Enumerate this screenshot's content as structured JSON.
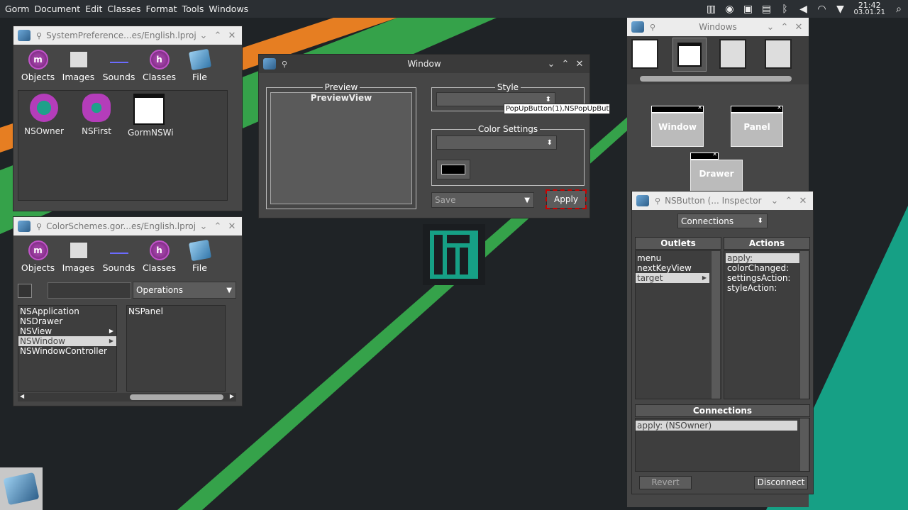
{
  "menubar": {
    "items": [
      "Gorm",
      "Document",
      "Edit",
      "Classes",
      "Format",
      "Tools",
      "Windows"
    ],
    "clock_time": "21:42",
    "clock_date": "03.01.21"
  },
  "palette": {
    "items": [
      "Objects",
      "Images",
      "Sounds",
      "Classes",
      "File"
    ]
  },
  "win_sysprefs": {
    "title": "SystemPreference...es/English.lproj",
    "objects": [
      "NSOwner",
      "NSFirst",
      "GormNSWi"
    ]
  },
  "win_colorschemes": {
    "title": "ColorSchemes.gor...es/English.lproj",
    "operations": "Operations",
    "classes": [
      "NSApplication",
      "NSDrawer",
      "NSView",
      "NSWindow",
      "NSWindowController"
    ],
    "subclasses": [
      "NSPanel"
    ]
  },
  "win_window": {
    "title": "Window",
    "preview_label": "Preview",
    "preview_view": "PreviewView",
    "style_label": "Style",
    "color_label": "Color Settings",
    "tooltip": "PopUpButton(1),NSPopUpButto",
    "save_popup": "Save",
    "apply_button": "Apply"
  },
  "win_windows": {
    "title": "Windows",
    "window_item": "Window",
    "panel_item": "Panel",
    "drawer_item": "Drawer"
  },
  "win_inspector": {
    "title": "NSButton (... Inspector",
    "mode_popup": "Connections",
    "outlets_header": "Outlets",
    "actions_header": "Actions",
    "outlets": [
      "menu",
      "nextKeyView",
      "target"
    ],
    "actions": [
      "apply:",
      "colorChanged:",
      "settingsAction:",
      "styleAction:"
    ],
    "connections_header": "Connections",
    "connections": [
      "apply: (NSOwner)"
    ],
    "revert_button": "Revert",
    "disconnect_button": "Disconnect"
  },
  "colors": {
    "desktop_bg": "#1f2326",
    "stripe_green": "#35a24a",
    "stripe_teal": "#16a085",
    "stripe_orange": "#e67e22",
    "selection_red": "#cc0000"
  }
}
